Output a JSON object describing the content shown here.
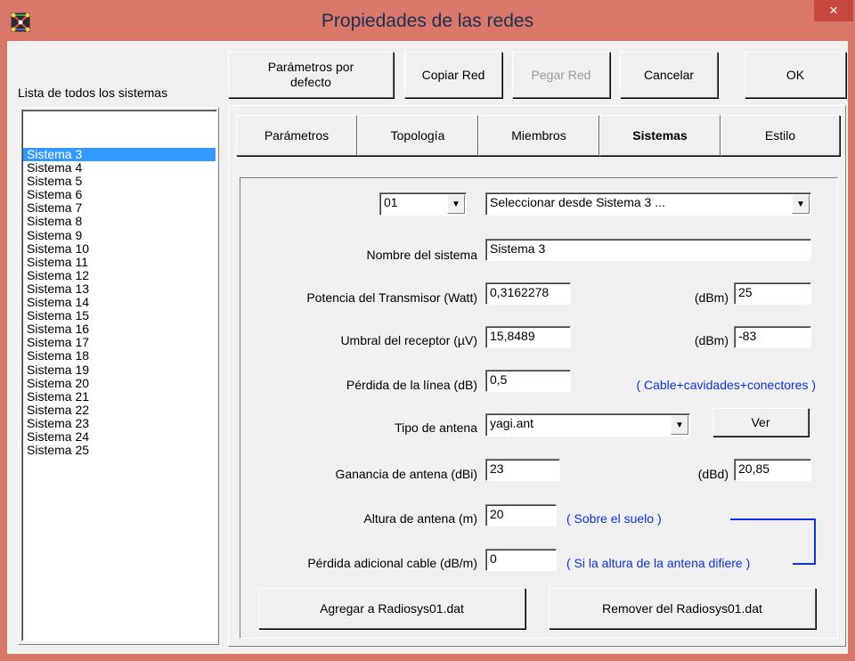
{
  "window": {
    "title": "Propiedades de las redes",
    "close_glyph": "×",
    "app_icon": "network-app-icon",
    "colors": {
      "titlebar": "#d9776b",
      "close": "#c7483c",
      "selection": "#3399ff",
      "link_text": "#1030e0"
    }
  },
  "systems_list": {
    "label": "Lista de todos los sistemas",
    "selected_index": 0,
    "items": [
      "Sistema  3",
      "Sistema  4",
      "Sistema  5",
      "Sistema  6",
      "Sistema  7",
      "Sistema  8",
      "Sistema  9",
      "Sistema 10",
      "Sistema 11",
      "Sistema 12",
      "Sistema 13",
      "Sistema 14",
      "Sistema 15",
      "Sistema 16",
      "Sistema 17",
      "Sistema 18",
      "Sistema 19",
      "Sistema 20",
      "Sistema 21",
      "Sistema 22",
      "Sistema 23",
      "Sistema 24",
      "Sistema 25"
    ]
  },
  "toolbar": {
    "defaults_line1": "Parámetros por",
    "defaults_line2": "defecto",
    "copy": "Copiar Red",
    "paste": "Pegar Red",
    "cancel": "Cancelar",
    "ok": "OK"
  },
  "tabs": [
    "Parámetros",
    "Topología",
    "Miembros",
    "Sistemas",
    "Estilo"
  ],
  "active_tab": "Sistemas",
  "form": {
    "number_select": "01",
    "source_select": "Seleccionar desde Sistema  3 ...",
    "name_label": "Nombre del sistema",
    "name_value": "Sistema  3",
    "tx_power_label": "Potencia del Transmisor (Watt)",
    "tx_power_value": "0,3162278",
    "dbm_label": "(dBm)",
    "tx_power_dbm": "25",
    "rx_threshold_label": "Umbral del receptor (µV)",
    "rx_threshold_value": "15,8489",
    "rx_threshold_dbm": "-83",
    "line_loss_label": "Pérdida de la línea (dB)",
    "line_loss_value": "0,5",
    "line_loss_note": "( Cable+cavidades+conectores )",
    "antenna_type_label": "Tipo de antena",
    "antenna_type_value": "yagi.ant",
    "view_button": "Ver",
    "gain_label": "Ganancia de antena (dBi)",
    "gain_value": "23",
    "dbd_label": "(dBd)",
    "gain_dbd": "20,85",
    "height_label": "Altura de antena (m)",
    "height_value": "20",
    "height_note": "( Sobre el suelo )",
    "extra_loss_label": "Pérdida adicional cable (dB/m)",
    "extra_loss_value": "0",
    "extra_loss_note": "( Si la altura de la antena difiere )",
    "add_button": "Agregar a Radiosys01.dat",
    "remove_button": "Remover del Radiosys01.dat"
  }
}
